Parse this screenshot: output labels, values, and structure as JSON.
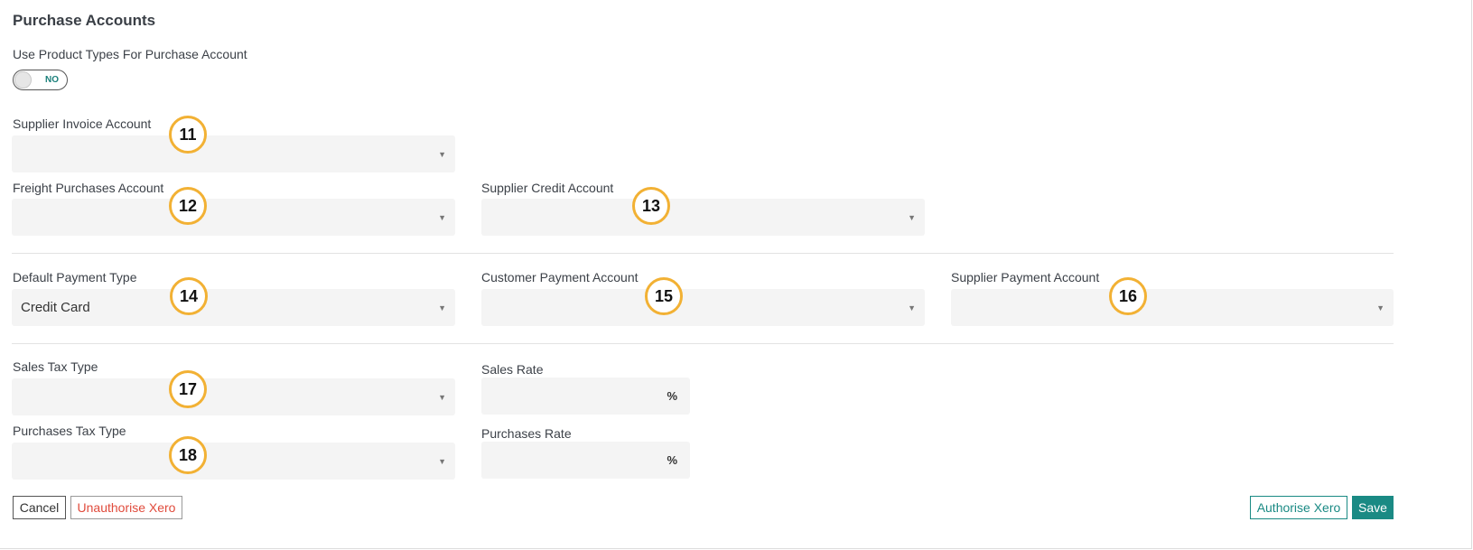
{
  "section": {
    "title": "Purchase Accounts"
  },
  "product_types": {
    "label": "Use Product Types For Purchase Account",
    "toggle_state": "NO"
  },
  "fields": {
    "supplier_invoice": {
      "label": "Supplier Invoice Account",
      "value": "",
      "badge": "11"
    },
    "freight_purchases": {
      "label": "Freight Purchases Account",
      "value": "",
      "badge": "12"
    },
    "supplier_credit": {
      "label": "Supplier Credit Account",
      "value": "",
      "badge": "13"
    },
    "default_payment_type": {
      "label": "Default Payment Type",
      "value": "Credit Card",
      "badge": "14"
    },
    "customer_payment": {
      "label": "Customer Payment Account",
      "value": "",
      "badge": "15"
    },
    "supplier_payment": {
      "label": "Supplier Payment Account",
      "value": "",
      "badge": "16"
    },
    "sales_tax_type": {
      "label": "Sales Tax Type",
      "value": "",
      "badge": "17"
    },
    "purchases_tax_type": {
      "label": "Purchases Tax Type",
      "value": "",
      "badge": "18"
    }
  },
  "rates": {
    "sales": {
      "label": "Sales Rate",
      "value": "",
      "unit": "%"
    },
    "purchases": {
      "label": "Purchases Rate",
      "value": "",
      "unit": "%"
    }
  },
  "icons": {
    "caret": "▼"
  },
  "buttons": {
    "cancel": "Cancel",
    "unauthorise": "Unauthorise Xero",
    "authorise": "Authorise Xero",
    "save": "Save"
  },
  "colors": {
    "accent": "#1a8a84",
    "danger": "#e04b3c",
    "badge_border": "#f2b134"
  }
}
